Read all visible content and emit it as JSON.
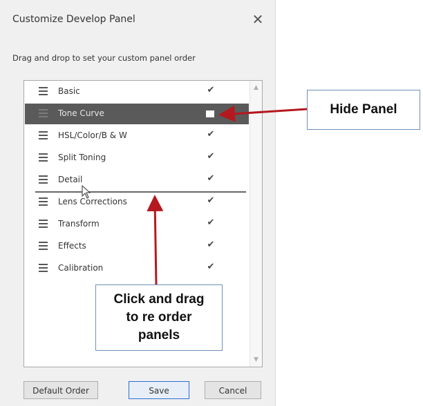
{
  "dialog": {
    "title": "Customize Develop Panel",
    "close_glyph": "✕",
    "instruction": "Drag and drop to set your custom panel order"
  },
  "panels": [
    {
      "label": "Basic",
      "checked": true
    },
    {
      "label": "Tone Curve",
      "checked": true,
      "selected": true
    },
    {
      "label": "HSL/Color/B & W",
      "checked": true
    },
    {
      "label": "Split Toning",
      "checked": true
    },
    {
      "label": "Detail",
      "checked": true
    },
    {
      "label": "Lens Corrections",
      "checked": true
    },
    {
      "label": "Transform",
      "checked": true
    },
    {
      "label": "Effects",
      "checked": true
    },
    {
      "label": "Calibration",
      "checked": true
    }
  ],
  "check_glyph": "✔",
  "buttons": {
    "default_order": "Default Order",
    "save": "Save",
    "cancel": "Cancel"
  },
  "callouts": {
    "hide_panel": "Hide Panel",
    "drag_line1": "Click and drag",
    "drag_line2": "to re order",
    "drag_line3": "panels"
  },
  "colors": {
    "selected_row": "#5a5a5a",
    "arrow": "#b3191e",
    "callout_border": "#6d8fb7"
  }
}
